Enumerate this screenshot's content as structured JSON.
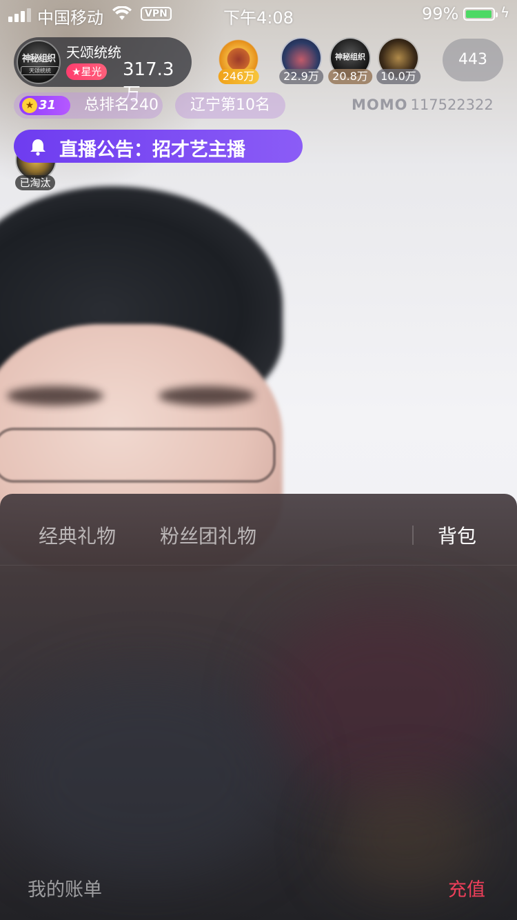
{
  "status_bar": {
    "carrier": "中国移动",
    "vpn": "VPN",
    "time": "下午4:08",
    "battery_pct": "99%",
    "battery_level": 0.99
  },
  "host": {
    "avatar_title": "神秘组织",
    "avatar_sub": "天颂统统",
    "name": "天颂统统",
    "badge": "★星光",
    "star_value": "317.3万"
  },
  "viewers": [
    {
      "tag": "246万"
    },
    {
      "tag": "22.9万"
    },
    {
      "avatar_title": "神秘组织",
      "tag": "20.8万"
    },
    {
      "tag": "10.0万"
    }
  ],
  "viewer_count": "443",
  "rank": {
    "level": "31",
    "total_rank": "总排名240",
    "region_rank": "辽宁第10名"
  },
  "momo": {
    "brand": "MOMO",
    "id": "117522322"
  },
  "announcement": {
    "text": "直播公告：招才艺主播"
  },
  "eliminated_label": "已淘汰",
  "gift_panel": {
    "tabs": [
      "经典礼物",
      "粉丝团礼物"
    ],
    "backpack_tab": "背包",
    "bill_link": "我的账单",
    "recharge": "充值"
  },
  "colors": {
    "accent_purple": "#7a45f3",
    "recharge_red": "#ef3f5a",
    "star_pink": "#ff3d6e",
    "battery_green": "#4cd964"
  }
}
